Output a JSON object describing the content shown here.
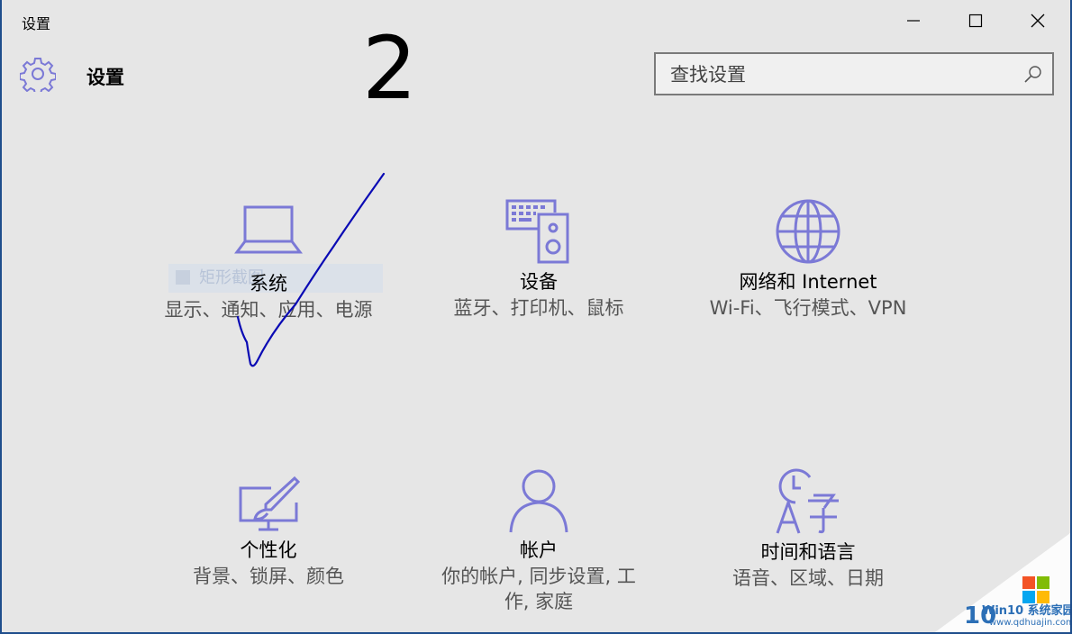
{
  "window": {
    "title": "设置"
  },
  "header": {
    "title": "设置",
    "handwritten_number": "2"
  },
  "search": {
    "placeholder": "查找设置"
  },
  "ghost_item": {
    "label": "矩形截图"
  },
  "tiles": [
    {
      "name": "系统",
      "desc": "显示、通知、应用、电源",
      "icon": "laptop-icon"
    },
    {
      "name": "设备",
      "desc": "蓝牙、打印机、鼠标",
      "icon": "devices-icon"
    },
    {
      "name": "网络和 Internet",
      "desc": "Wi-Fi、飞行模式、VPN",
      "icon": "globe-icon"
    },
    {
      "name": "个性化",
      "desc": "背景、锁屏、颜色",
      "icon": "personalization-icon"
    },
    {
      "name": "帐户",
      "desc": "你的帐户, 同步设置, 工作, 家庭",
      "icon": "person-icon"
    },
    {
      "name": "时间和语言",
      "desc": "语音、区域、日期",
      "icon": "time-language-icon"
    }
  ],
  "watermark": {
    "logo_text": "Win10 系统家园",
    "url": "www.qdhuajin.com"
  },
  "colors": {
    "accent_icon": "#7b79d6",
    "window_border": "#1f4e8c",
    "background": "#e6e6e6",
    "check_mark": "#0a0ab4"
  }
}
